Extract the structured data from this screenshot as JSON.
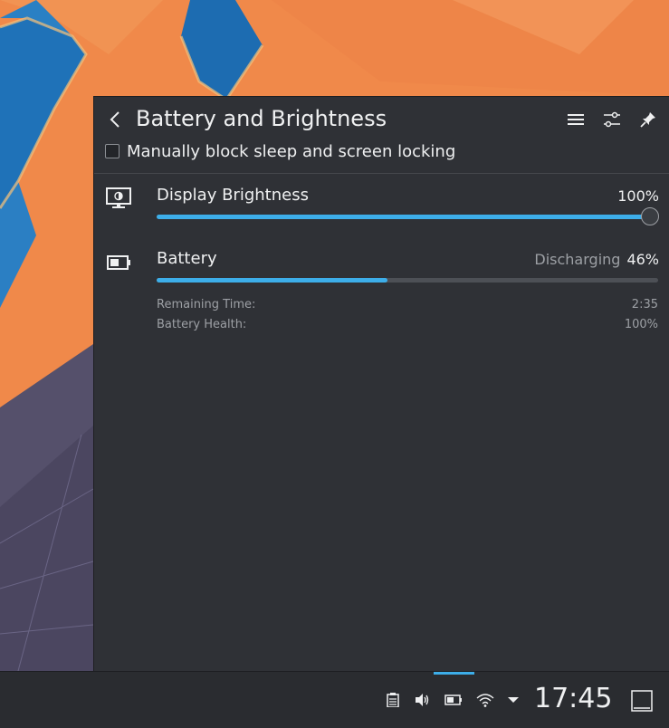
{
  "popup": {
    "title": "Battery and Brightness",
    "inhibit_label": "Manually block sleep and screen locking",
    "inhibit_checked": false,
    "header_icons": [
      "back-arrow-icon",
      "hamburger-menu-icon",
      "configure-icon",
      "pin-icon"
    ]
  },
  "brightness": {
    "label": "Display Brightness",
    "value": "100%",
    "level": 1.0,
    "icon": "display-brightness-icon"
  },
  "battery": {
    "label": "Battery",
    "status": "Discharging",
    "value": "46%",
    "level": 0.46,
    "icon": "battery-icon",
    "remaining_label": "Remaining Time:",
    "remaining_value": "2:35",
    "health_label": "Battery Health:",
    "health_value": "100%"
  },
  "taskbar": {
    "clock": "17:45",
    "tray_icons": [
      "clipboard-icon",
      "volume-icon",
      "battery-tray-icon",
      "wifi-icon",
      "expand-tray-icon",
      "show-desktop-icon"
    ]
  },
  "colors": {
    "accent": "#3daee9",
    "popup_bg": "#2f3136",
    "wallpaper_orange": "#f28c4a",
    "wallpaper_blue": "#1c6bb0"
  }
}
